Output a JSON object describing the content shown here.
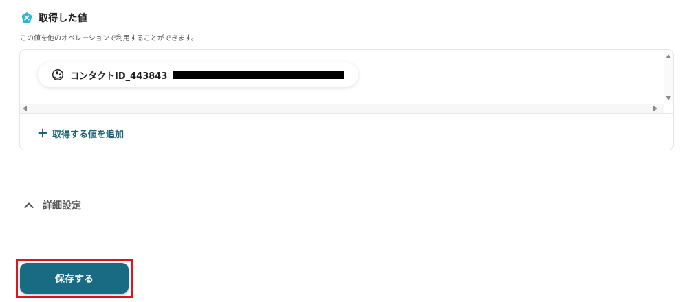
{
  "section": {
    "title": "取得した値",
    "description": "この値を他のオペレーションで利用することができます。"
  },
  "values": [
    {
      "label": "コンタクトID_443843",
      "icon": "mailchimp-icon",
      "redacted": true
    }
  ],
  "add_value_label": "取得する値を追加",
  "advanced_settings_label": "詳細設定",
  "save_label": "保存する",
  "colors": {
    "accent": "#186b82",
    "link": "#1c637a",
    "highlight": "#e0141e",
    "section_icon": "#2bb5d8"
  }
}
